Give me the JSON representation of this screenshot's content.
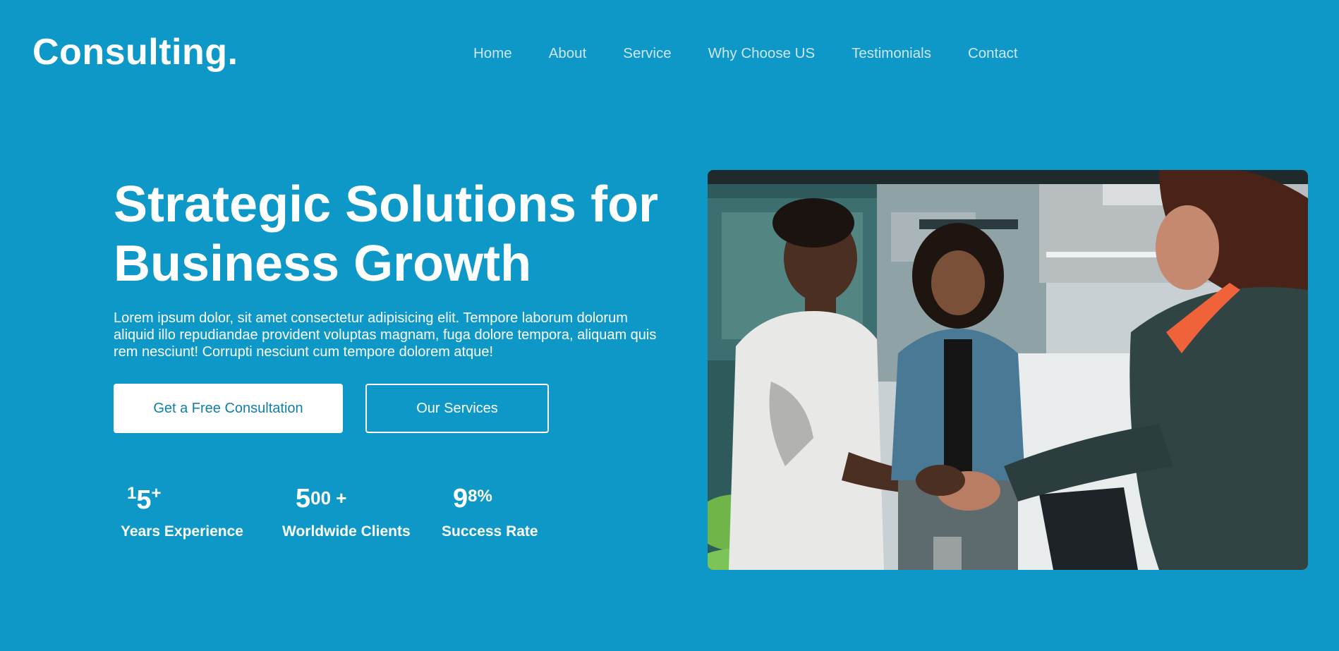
{
  "header": {
    "logo": "Consulting.",
    "nav": [
      "Home",
      "About",
      "Service",
      "Why Choose US",
      "Testimonials",
      "Contact"
    ]
  },
  "hero": {
    "title_line1": "Strategic Solutions for",
    "title_line2": "Business Growth",
    "description": "Lorem ipsum dolor, sit amet consectetur adipisicing elit. Tempore laborum dolorum aliquid illo repudiandae provident voluptas magnam, fuga dolore tempora, aliquam quis rem nesciunt! Corrupti nesciunt cum tempore dolorem atque!",
    "primary_button": "Get a Free Consultation",
    "secondary_button": "Our Services"
  },
  "stats": [
    {
      "lead": "1",
      "main": "5",
      "suffix": "+",
      "label": "Years Experience"
    },
    {
      "lead": "",
      "main": "5",
      "suffix": "00 +",
      "label": "Worldwide Clients"
    },
    {
      "lead": "",
      "main": "9",
      "suffix": "8%",
      "label": "Success Rate"
    }
  ],
  "colors": {
    "background": "#0e98c7",
    "text": "#ffffff",
    "nav_text": "#cde6f0",
    "primary_button_text": "#0e7fa9"
  }
}
